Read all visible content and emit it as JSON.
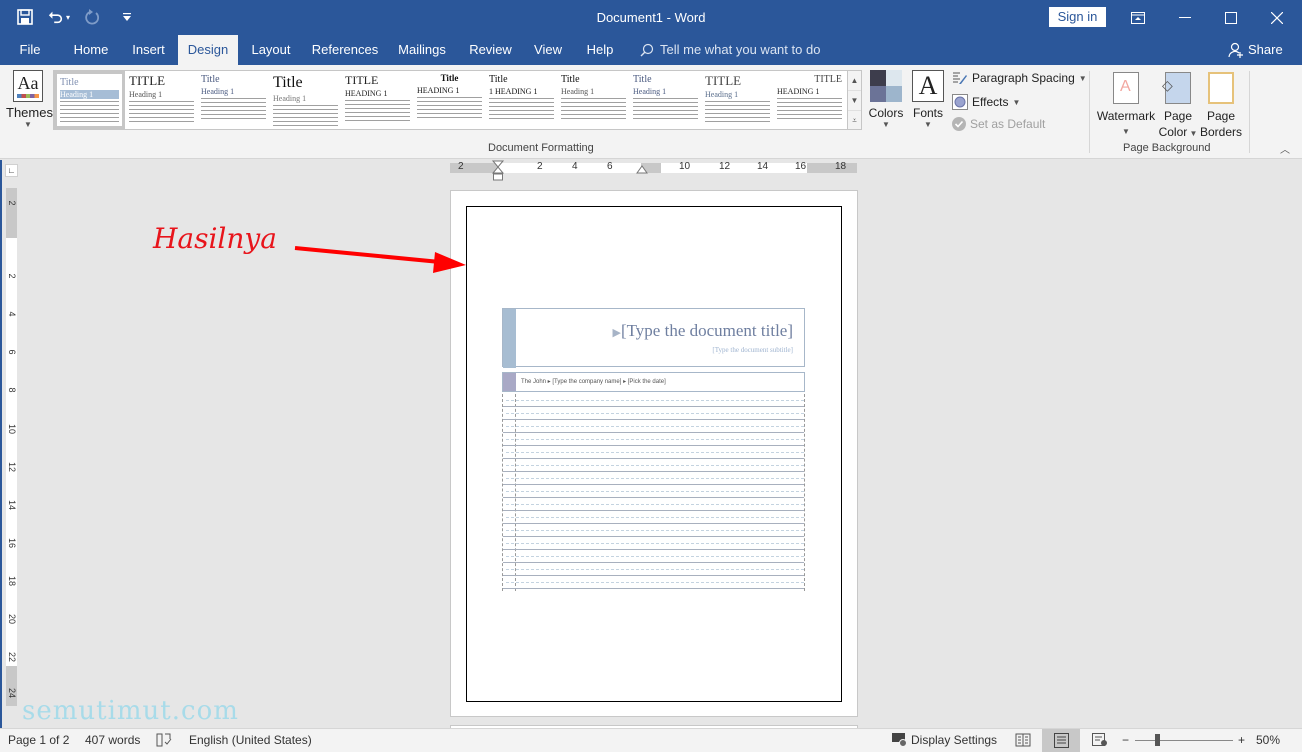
{
  "window": {
    "doc_title": "Document1  -  Word",
    "sign_in": "Sign in",
    "qat": [
      {
        "icon": "save-icon",
        "glyph": "🖫"
      },
      {
        "icon": "undo-icon",
        "glyph": "↶"
      },
      {
        "icon": "redo-icon",
        "glyph": "↻"
      },
      {
        "icon": "customize-qat-icon",
        "glyph": "⩡"
      }
    ],
    "controls": {
      "ribbon_display": "⊡",
      "minimize": "—",
      "maximize": "☐",
      "close": "✕"
    }
  },
  "tabs": [
    "File",
    "Home",
    "Insert",
    "Design",
    "Layout",
    "References",
    "Mailings",
    "Review",
    "View",
    "Help"
  ],
  "active_tab": "Design",
  "tell_me": {
    "placeholder": "Tell me what you want to do",
    "icon": "⚲"
  },
  "share": {
    "label": "Share",
    "icon": "👤"
  },
  "ribbon": {
    "themes_label": "Themes",
    "gallery_items": [
      {
        "title": "Title",
        "heading": "Heading 1"
      },
      {
        "title": "TITLE",
        "heading": "Heading 1"
      },
      {
        "title": "Title",
        "heading": "Heading 1"
      },
      {
        "title": "Title",
        "heading": "Heading 1"
      },
      {
        "title": "TITLE",
        "heading": "HEADING 1"
      },
      {
        "title": "Title",
        "heading": "HEADING 1"
      },
      {
        "title": "Title",
        "heading": "1  HEADING 1"
      },
      {
        "title": "Title",
        "heading": "Heading 1"
      },
      {
        "title": "Title",
        "heading": "Heading 1"
      },
      {
        "title": "TITLE",
        "heading": "Heading 1"
      },
      {
        "title": "TITLE",
        "heading": "HEADING 1"
      }
    ],
    "colors_label": "Colors",
    "fonts_label": "Fonts",
    "paragraph_spacing": "Paragraph Spacing",
    "effects": "Effects",
    "set_as_default": "Set as Default",
    "document_formatting_label": "Document Formatting",
    "watermark": "Watermark",
    "page_color": "Page Color",
    "page_color_l1": "Page",
    "page_color_l2": "Color",
    "page_borders_l1": "Page",
    "page_borders_l2": "Borders",
    "page_background_label": "Page Background",
    "theme_colors": [
      "#3d3d4c",
      "#dde7ee",
      "#6b7397",
      "#9db5cc"
    ]
  },
  "ruler": {
    "h_labels": [
      "2",
      "2",
      "4",
      "6",
      "10",
      "12",
      "14",
      "16",
      "18"
    ],
    "v_labels": [
      "2",
      "2",
      "4",
      "6",
      "8",
      "10",
      "12",
      "14",
      "16",
      "18",
      "20",
      "22",
      "24"
    ]
  },
  "document": {
    "title_placeholder": "[Type the document title]",
    "subtitle_placeholder": "[Type the document subtitle]",
    "meta_line": "The John ▸ [Type the company name] ▸ [Pick the date]",
    "line_count": 15
  },
  "annotation": {
    "text": "Hasilnya",
    "color": "#e8141b"
  },
  "watermark_text": "semutimut.com",
  "status": {
    "page": "Page 1 of 2",
    "words": "407 words",
    "language": "English (United States)",
    "display_settings": "Display Settings",
    "zoom_percent": "50%",
    "zoom_minus": "−",
    "zoom_plus": "+"
  },
  "colors": {
    "brand": "#2b579a",
    "ribbon_bg": "#f3f3f3",
    "canvas_bg": "#e6e6e6"
  }
}
